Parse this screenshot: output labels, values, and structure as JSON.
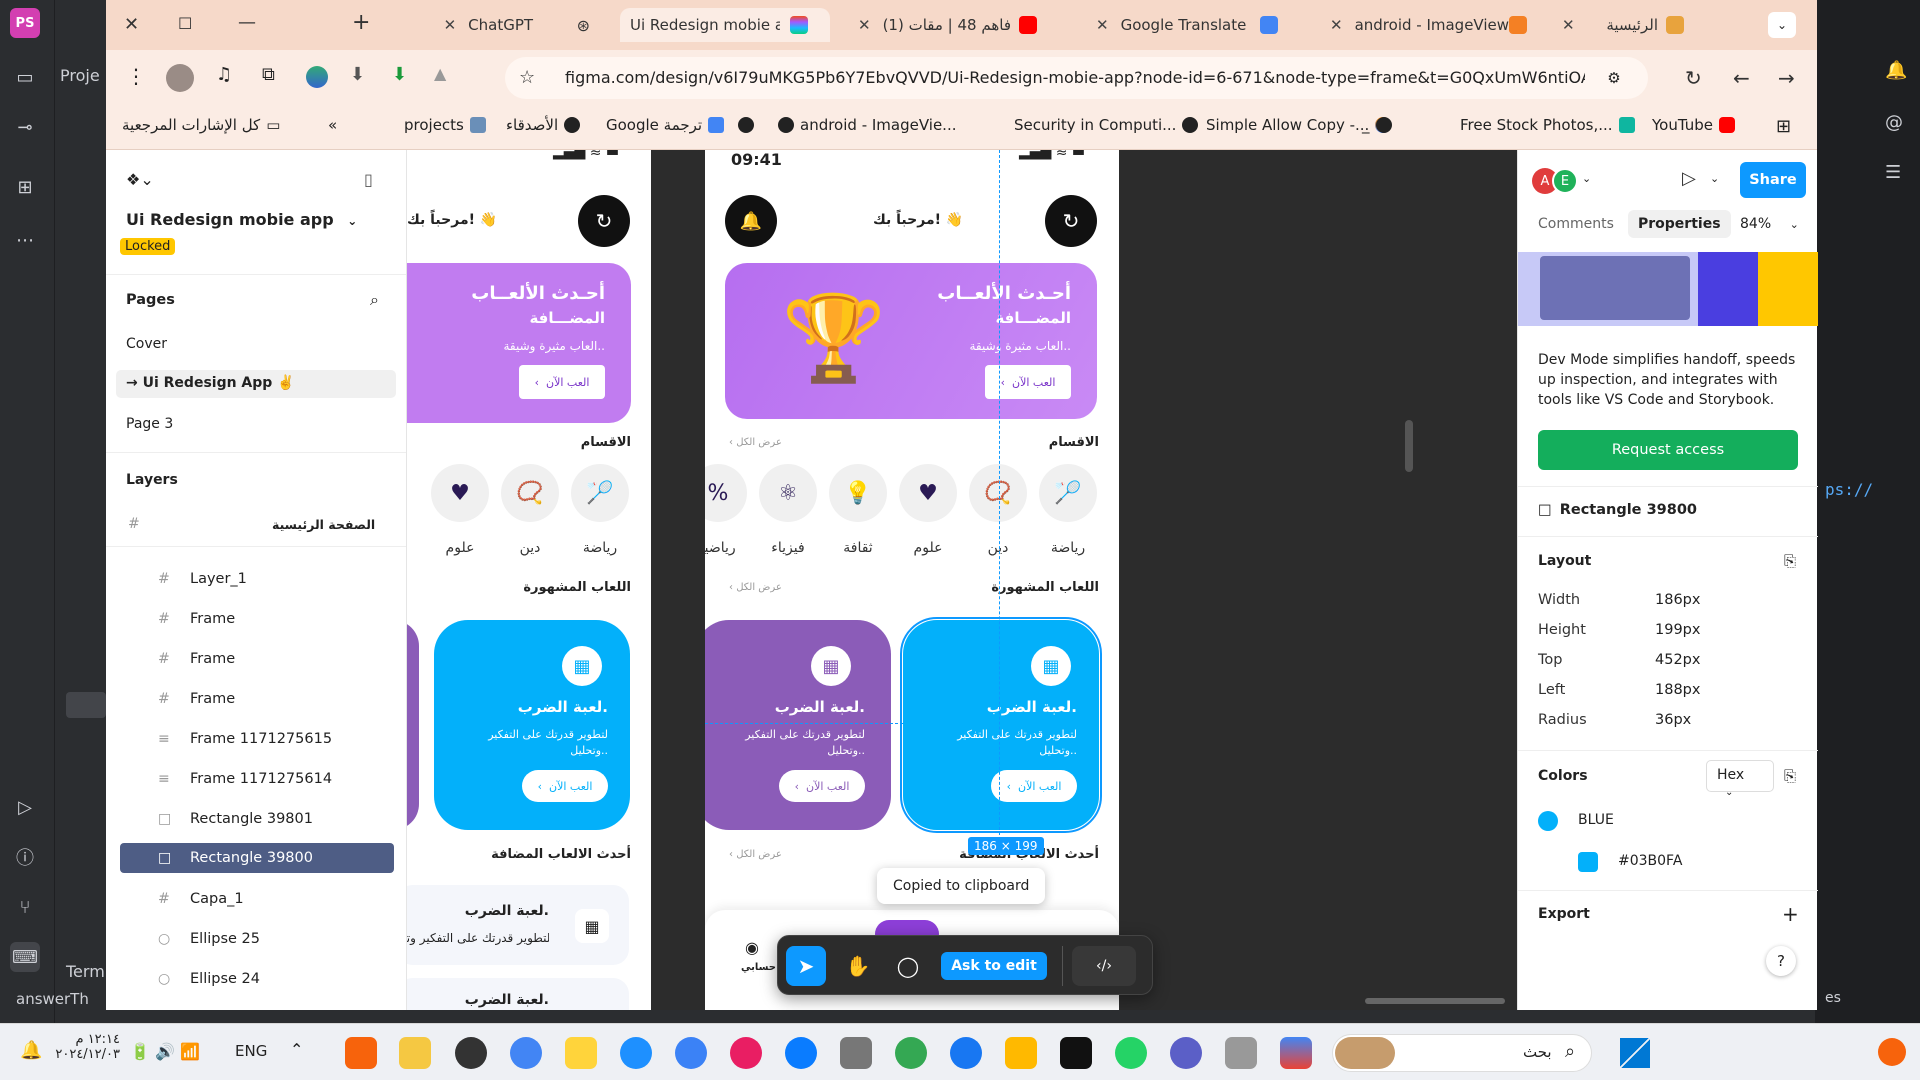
{
  "ide": {
    "project_label": "Proje",
    "terminal_label": "Term",
    "answer_label": "answerTh",
    "url_hint": "ps://",
    "es_label": "es"
  },
  "browser": {
    "tabs": [
      {
        "title": "ChatGPT"
      },
      {
        "title": "Ui Redesign mobie ap"
      },
      {
        "title": "(1) فاهم 48 | مقات"
      },
      {
        "title": "Google Translate"
      },
      {
        "title": "android - ImageView"
      },
      {
        "title": "الرئيسية"
      }
    ],
    "url": "figma.com/design/v6I79uMKG5Pb6Y7EbvQVVD/Ui-Redesign-mobie-app?node-id=6-671&node-type=frame&t=G0QxUmW6ntiOAVdb-0",
    "bookmarks": [
      "كل الإشارات المرجعية",
      "projects",
      "الأصدقاء",
      "Google ترجمة",
      "android - ImageVie...",
      "Security in Computi...",
      "Simple Allow Copy -...",
      "_",
      "Free Stock Photos,...",
      "YouTube"
    ]
  },
  "figma_left": {
    "file_name": "Ui Redesign mobie app",
    "locked_badge": "Locked",
    "pages_title": "Pages",
    "pages": [
      "Cover",
      "→ Ui Redesign App ✌️",
      "Page 3"
    ],
    "layers_title": "Layers",
    "root_layer": "الصفحة الرئيسية",
    "layers": [
      "Layer_1",
      "Frame",
      "Frame",
      "Frame",
      "Frame 1171275615",
      "Frame 1171275614",
      "Rectangle 39801",
      "Rectangle 39800",
      "Capa_1",
      "Ellipse 25",
      "Ellipse 24"
    ]
  },
  "phone": {
    "time": "09:41",
    "greeting": "مرحباً بك! 👋",
    "banner_title1": "أحـدث الألعــاب",
    "banner_title2": "المضـــافة",
    "banner_sub": "العاب مثيرة وشيقة..",
    "play_now": "العب الآن",
    "sections_title": "الاقسام",
    "view_all": "عرض الكل",
    "categories": [
      "رياضة",
      "دين",
      "علوم",
      "ثقافة",
      "فيزياء",
      "رياضيا"
    ],
    "popular_title": "اللعاب المشهورة",
    "card_title": "لعبة الضرب.",
    "card_desc1": "لتطوير قدرتك على التفكير",
    "card_desc2": "وتحليل..",
    "latest_title": "أحدث الالعاب المضافة",
    "list_title": "لعبة الضرب.",
    "list_desc": "لتطوير قدرتك على التفكير وتح",
    "nav_profile": "حسابي"
  },
  "canvas": {
    "size_badge": "186 × 199",
    "toast": "Copied to clipboard",
    "ask_edit": "Ask to edit"
  },
  "figma_right": {
    "avatars": [
      "A",
      "E"
    ],
    "share": "Share",
    "tabs": [
      "Comments",
      "Properties"
    ],
    "zoom": "84%",
    "devmode_text": "Dev Mode simplifies handoff, speeds up inspection, and integrates with tools like VS Code and Storybook.",
    "request_access": "Request access",
    "selection": "Rectangle 39800",
    "layout_title": "Layout",
    "layout": [
      {
        "k": "Width",
        "v": "186px"
      },
      {
        "k": "Height",
        "v": "199px"
      },
      {
        "k": "Top",
        "v": "452px"
      },
      {
        "k": "Left",
        "v": "188px"
      },
      {
        "k": "Radius",
        "v": "36px"
      }
    ],
    "colors_title": "Colors",
    "color_format": "Hex",
    "color_name": "BLUE",
    "color_hex": "#03B0FA",
    "export_title": "Export",
    "help": "?"
  },
  "taskbar": {
    "time": "١٢:١٤ م",
    "date": "٢٠٢٤/١٢/٠٣",
    "lang": "ENG",
    "search": "بحث"
  },
  "colors": {
    "accent": "#0d99ff",
    "purple": "#c17cf0",
    "blue": "#03B0FA",
    "violet": "#8b5cb8",
    "green": "#14ae5c"
  }
}
